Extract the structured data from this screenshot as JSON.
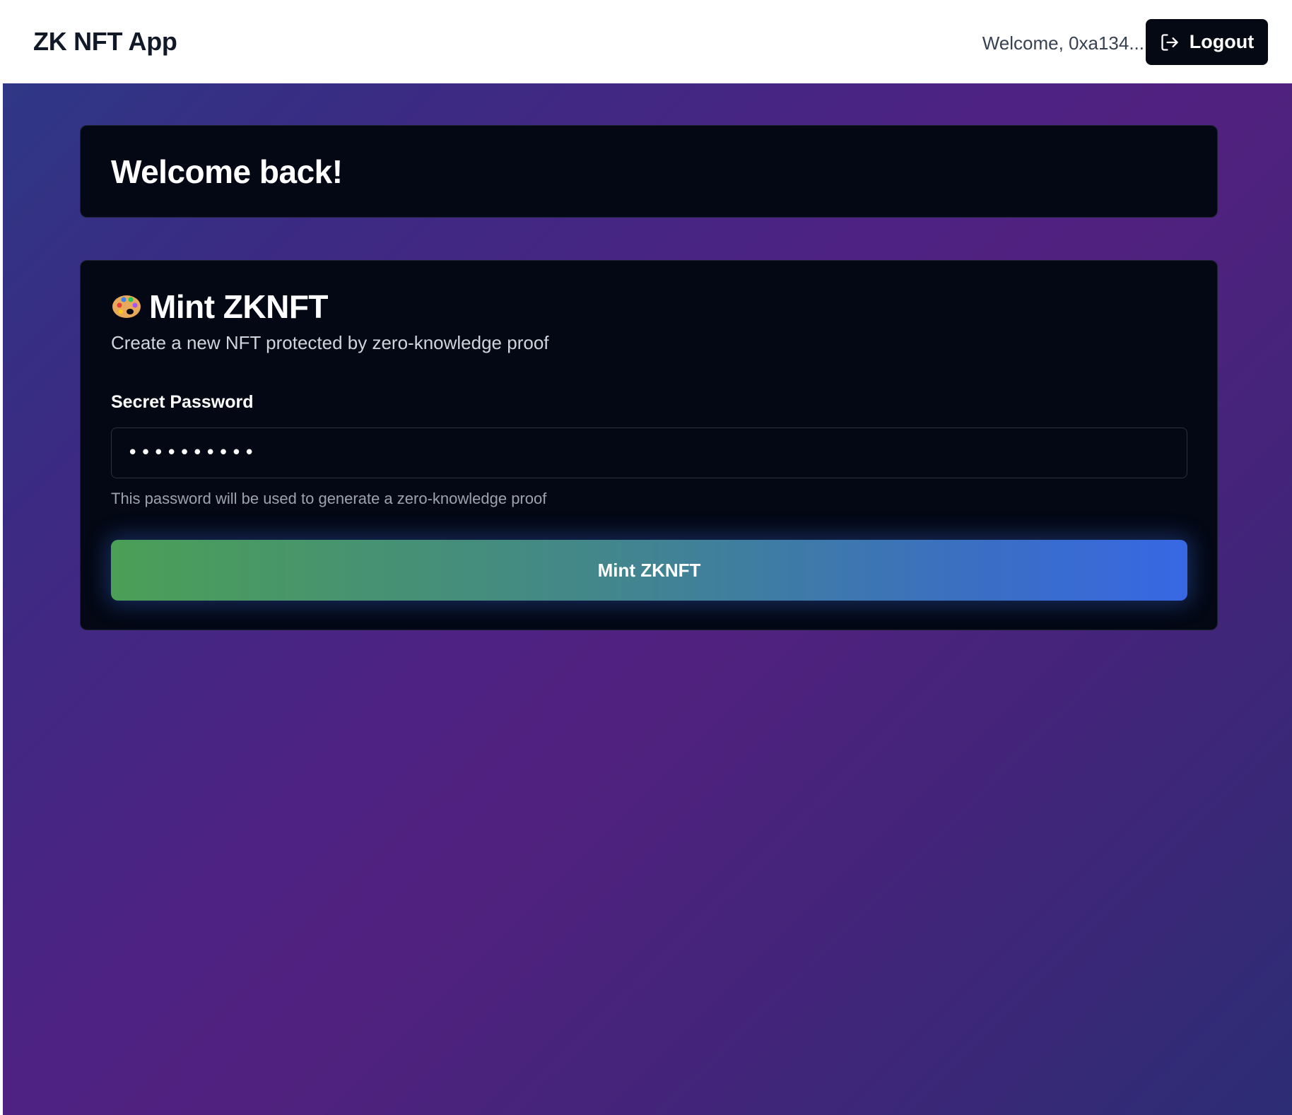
{
  "header": {
    "brand": "ZK NFT App",
    "welcome_text": "Welcome, 0xa134...",
    "logout_label": "Logout"
  },
  "welcome_card": {
    "heading": "Welcome back!"
  },
  "mint_card": {
    "icon": "palette-icon",
    "title": "Mint ZKNFT",
    "subtitle": "Create a new NFT protected by zero-knowledge proof",
    "password_label": "Secret Password",
    "password_value": "••••••••••",
    "password_hint": "This password will be used to generate a zero-knowledge proof",
    "submit_label": "Mint ZKNFT"
  },
  "colors": {
    "header_bg": "#ffffff",
    "card_bg": "#030814",
    "button_gradient_start": "#4b9f56",
    "button_gradient_end": "#3867e4",
    "page_gradient": [
      "#2c3a86",
      "#51217f",
      "#2c2d74"
    ]
  }
}
